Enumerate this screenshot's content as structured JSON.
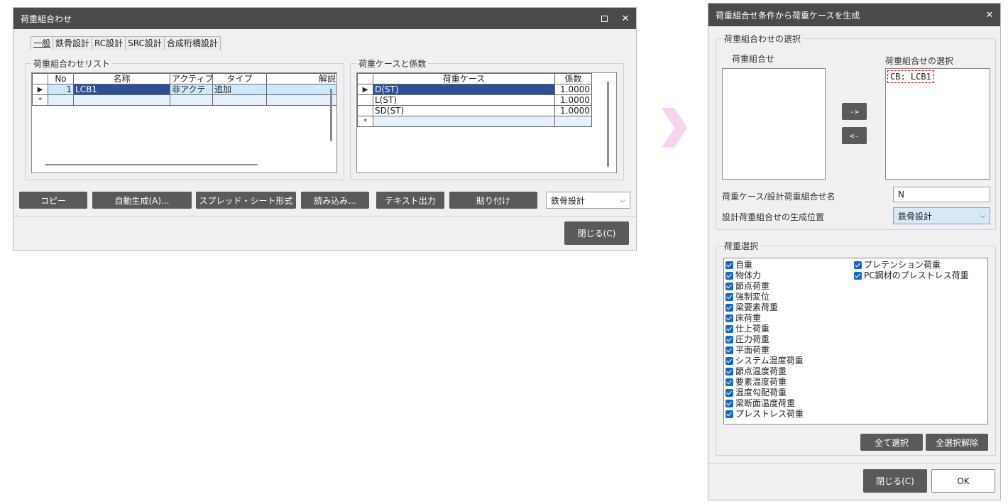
{
  "left_window": {
    "title": "荷重組合わせ",
    "tabs": [
      "一般",
      "鉄骨設計",
      "RC設計",
      "SRC設計",
      "合成桁橋設計"
    ],
    "combo_list": {
      "legend": "荷重組合わせリスト",
      "columns": [
        "No",
        "名称",
        "アクティブ",
        "タイプ",
        "解説"
      ],
      "rows": [
        {
          "no": "1",
          "name": "LCB1",
          "active": "非アクテ",
          "type": "追加",
          "desc": ""
        }
      ],
      "new_row_marker": "*",
      "current_row_marker": "▶"
    },
    "case_factor": {
      "legend": "荷重ケースと係数",
      "columns": [
        "荷重ケース",
        "係数"
      ],
      "rows": [
        {
          "case": "D(ST)",
          "factor": "1.0000"
        },
        {
          "case": "L(ST)",
          "factor": "1.0000"
        },
        {
          "case": "SD(ST)",
          "factor": "1.0000"
        }
      ],
      "new_row_marker": "*",
      "current_row_marker": "▶"
    },
    "buttons": {
      "copy": "コピー",
      "auto": "自動生成(A)...",
      "spread": "スプレッド・シート形式",
      "load": "読み込み...",
      "text_out": "テキスト出力",
      "paste": "貼り付け",
      "close": "閉じる(C)"
    },
    "design_select": "鉄骨設計"
  },
  "right_window": {
    "title": "荷重組合せ条件から荷重ケースを生成",
    "selection_legend": "荷重組合わせの選択",
    "left_list_label": "荷重組合せ",
    "right_list_label": "荷重組合せの選択",
    "selected_item": "CB: LCB1",
    "add_button": "->",
    "remove_button": "<-",
    "name_label": "荷重ケース/設計荷重組合せ名",
    "name_value": "N",
    "position_label": "設計荷重組合せの生成位置",
    "position_value": "鉄骨設計",
    "load_legend": "荷重選択",
    "loads_col1": [
      "自重",
      "物体力",
      "節点荷重",
      "強制変位",
      "梁要素荷重",
      "床荷重",
      "仕上荷重",
      "圧力荷重",
      "平面荷重",
      "システム温度荷重",
      "節点温度荷重",
      "要素温度荷重",
      "温度勾配荷重",
      "梁断面温度荷重",
      "プレストレス荷重"
    ],
    "loads_col2": [
      "プレテンション荷重",
      "PC鋼材のプレストレス荷重"
    ],
    "select_all": "全て選択",
    "deselect_all": "全選択解除",
    "close": "閉じる(C)",
    "ok": "OK"
  },
  "colors": {
    "titlebar": "#4a4a4a",
    "selection": "#2d4f97",
    "checkbox": "#1868c4",
    "arrow": "#f6d4ee",
    "highlight_border": "#d01010"
  }
}
